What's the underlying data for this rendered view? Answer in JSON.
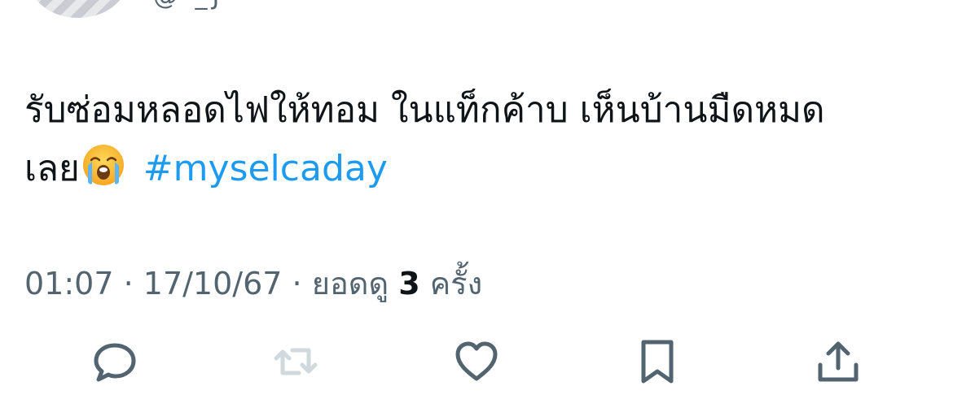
{
  "tweet": {
    "author_handle_fragment": "@ _J",
    "text_line1": "รับซ่อมหลอดไฟให้ทอม ในแท็กค้าบ เห็นบ้านมืดหมด",
    "text_line2": "เลย",
    "emoji": "loudly-crying-face-emoji",
    "hashtag": "#myselcaday"
  },
  "meta": {
    "time": "01:07",
    "separator1": " · ",
    "date": "17/10/67",
    "separator2": " · ",
    "views_prefix": "ยอดดู ",
    "views_count": "3",
    "views_suffix": " ครั้ง"
  },
  "actions": [
    {
      "name": "reply",
      "icon": "reply-icon",
      "enabled": true
    },
    {
      "name": "retweet",
      "icon": "retweet-icon",
      "enabled": false
    },
    {
      "name": "like",
      "icon": "heart-icon",
      "enabled": true
    },
    {
      "name": "bookmark",
      "icon": "bookmark-icon",
      "enabled": true
    },
    {
      "name": "share",
      "icon": "share-icon",
      "enabled": true
    }
  ],
  "colors": {
    "text": "#0f1419",
    "secondary": "#536471",
    "link": "#1d9bf0",
    "icon": "#536471",
    "icon_disabled": "#cfd9de"
  }
}
